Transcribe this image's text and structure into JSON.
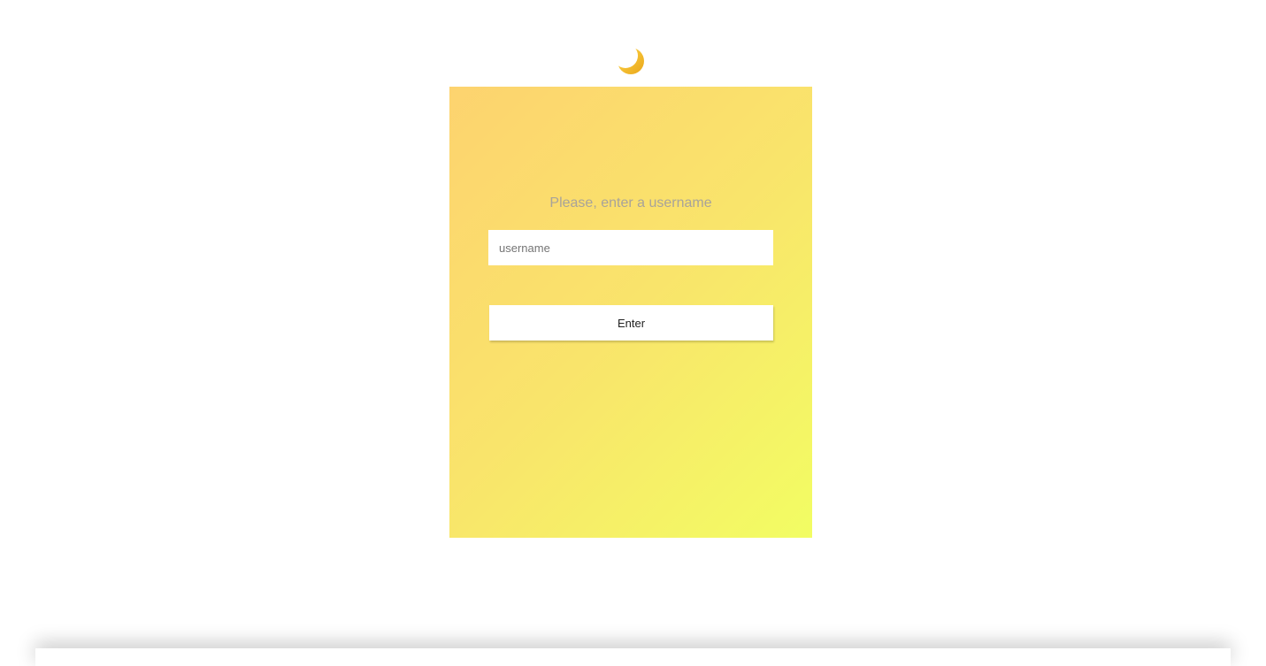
{
  "theme_toggle": {
    "icon": "crescent-moon-icon",
    "color": "#f5b921"
  },
  "login_card": {
    "gradient_start": "#fdd36f",
    "gradient_end": "#f2fd63",
    "prompt_text": "Please, enter a username",
    "username_input": {
      "value": "",
      "placeholder": "username"
    },
    "enter_button_label": "Enter"
  }
}
